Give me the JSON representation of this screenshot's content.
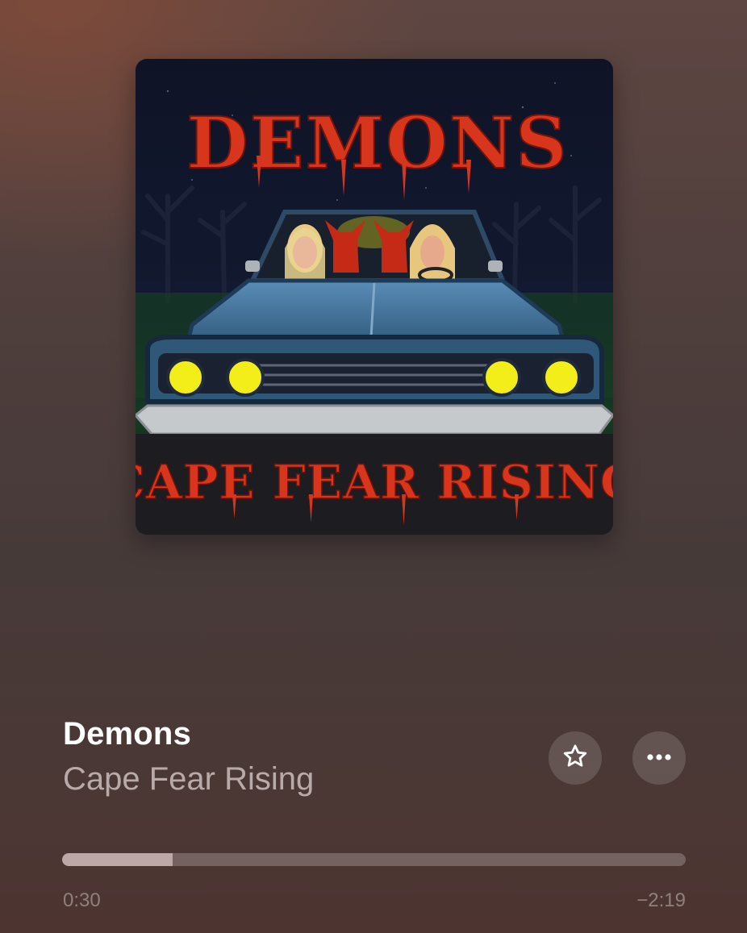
{
  "artwork": {
    "title_text": "DEMONS",
    "artist_text": "CAPE FEAR RISING"
  },
  "track": {
    "title": "Demons",
    "artist": "Cape Fear Rising"
  },
  "controls": {
    "favorite_icon": "star-icon",
    "more_icon": "ellipsis-icon"
  },
  "playback": {
    "elapsed": "0:30",
    "remaining": "−2:19",
    "progress_fraction": 0.1776
  },
  "colors": {
    "title_red": "#d8361c",
    "car_blue": "#3f6f95",
    "headlight_yellow": "#f3ee1a"
  }
}
